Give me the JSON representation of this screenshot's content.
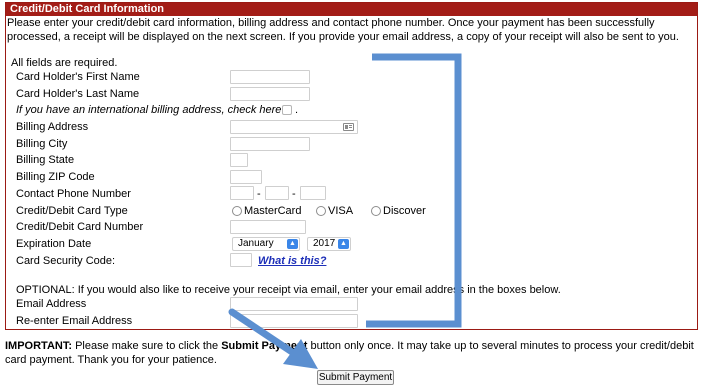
{
  "panel": {
    "title": "Credit/Debit Card Information",
    "intro": "Please enter your credit/debit card information, billing address and contact phone number. Once your payment has been successfully processed, a receipt will be displayed on the next screen. If you provide your email address, a copy of your receipt will also be sent to you.",
    "required_note": "All fields are required."
  },
  "form": {
    "first_name_label": "Card Holder's First Name",
    "last_name_label": "Card Holder's Last Name",
    "intl_label": "If you have an international billing address, check here",
    "intl_suffix": ".",
    "billing_address_label": "Billing Address",
    "billing_city_label": "Billing City",
    "billing_state_label": "Billing State",
    "billing_zip_label": "Billing ZIP Code",
    "phone_label": "Contact Phone Number",
    "phone_sep": "-",
    "card_type_label": "Credit/Debit Card Type",
    "card_types": [
      "MasterCard",
      "VISA",
      "Discover"
    ],
    "card_number_label": "Credit/Debit Card Number",
    "expiration_label": "Expiration Date",
    "exp_month": "January",
    "exp_year": "2017",
    "security_label": "Card Security Code:",
    "security_link": "What is this?",
    "optional_note": "OPTIONAL: If you would also like to receive your receipt via email, enter your email address in the boxes below.",
    "email_label": "Email Address",
    "email_reenter_label": "Re-enter Email Address"
  },
  "footer": {
    "important_bold": "IMPORTANT:",
    "important_text_1": " Please make sure to click the ",
    "important_button_name": "Submit Payment",
    "important_text_2": " button only once. It may take up to several minutes to process your credit/debit card payment. Thank you for your patience.",
    "submit_label": "Submit Payment"
  },
  "annotation": {
    "color": "#5b8fd0"
  }
}
